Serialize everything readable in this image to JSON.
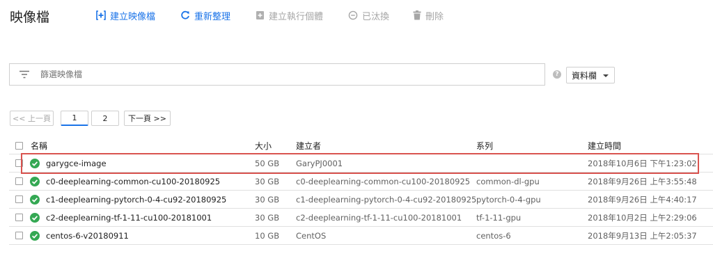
{
  "page": {
    "title": "映像檔"
  },
  "toolbar": {
    "create_image": "建立映像檔",
    "refresh": "重新整理",
    "create_instance": "建立執行個體",
    "deprecate": "已汰換",
    "delete": "刪除"
  },
  "filter": {
    "placeholder": "篩選映像檔"
  },
  "columns_button": {
    "label": "資料欄"
  },
  "help_icon": {
    "glyph": "?"
  },
  "pagination": {
    "prev": "<< 上一頁",
    "page1": "1",
    "page2": "2",
    "next": "下一頁 >>"
  },
  "table": {
    "headers": {
      "name": "名稱",
      "size": "大小",
      "creator": "建立者",
      "family": "系列",
      "created": "建立時間"
    },
    "rows": [
      {
        "name": "garygce-image",
        "size": "50 GB",
        "creator": "GaryPJ0001",
        "family": "",
        "created": "2018年10月6日 下午1:23:02"
      },
      {
        "name": "c0-deeplearning-common-cu100-20180925",
        "size": "30 GB",
        "creator": "c0-deeplearning-common-cu100-20180925",
        "family": "common-dl-gpu",
        "created": "2018年9月26日 上午3:55:48"
      },
      {
        "name": "c1-deeplearning-pytorch-0-4-cu92-20180925",
        "size": "30 GB",
        "creator": "c1-deeplearning-pytorch-0-4-cu92-20180925",
        "family": "pytorch-0-4-gpu",
        "created": "2018年9月26日 上午4:40:17"
      },
      {
        "name": "c2-deeplearning-tf-1-11-cu100-20181001",
        "size": "30 GB",
        "creator": "c2-deeplearning-tf-1-11-cu100-20181001",
        "family": "tf-1-11-gpu",
        "created": "2018年10月2日 上午2:29:06"
      },
      {
        "name": "centos-6-v20180911",
        "size": "10 GB",
        "creator": "CentOS",
        "family": "centos-6",
        "created": "2018年9月13日 上午2:05:37"
      }
    ]
  },
  "colors": {
    "accent": "#1a73e8",
    "status_ok": "#34a853",
    "highlight": "#d9534f",
    "disabled": "#a6a6a6"
  }
}
